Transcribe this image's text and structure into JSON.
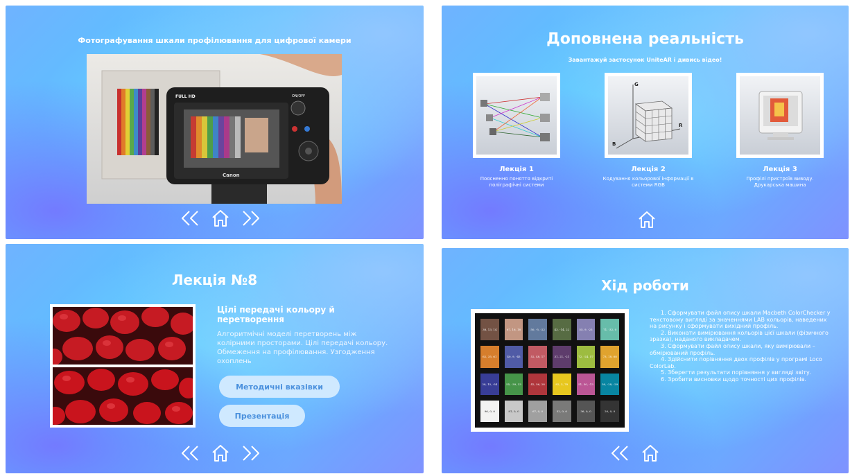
{
  "slide1": {
    "title": "Фотографування шкали профілювання для цифрової камери",
    "camera": {
      "label_fullhd": "FULL HD",
      "label_onoff": "ON/OFF",
      "brand": "Canon"
    }
  },
  "slide2": {
    "title": "Доповнена реальність",
    "subtitle": "Завантажуй застосунок UniteAR і дивись відео!",
    "lectures": [
      {
        "title": "Лекція 1",
        "desc": "Пояснення поняття відкриті поліграфічні системи"
      },
      {
        "title": "Лекція 2",
        "desc": "Кодування кольорової інформації в системи RGB",
        "axes": [
          "G",
          "B",
          "R"
        ]
      },
      {
        "title": "Лекція 3",
        "desc": "Профілі пристроїв виводу. Друкарська машина"
      }
    ]
  },
  "slide3": {
    "title": "Лекція №8",
    "heading": "Цілі передачі кольору й перетворення",
    "body": "Алгоритмічні моделі перетворень між колірними просторами. Цілі передачі кольору. Обмеження на профілювання. Узгодження охоплень",
    "buttons": {
      "guide": "Методичні вказівки",
      "presentation": "Презентація"
    }
  },
  "slide4": {
    "title": "Хід роботи",
    "steps": [
      "1. Сформувати файл опису шкали Macbeth ColorChecker у текстовому вигляді за значеннями LAB кольорів, наведених на рисунку і сформувати вихідний профіль.",
      "2. Виконати вимірювання кольорів цієї шкали (фізичного зразка), наданого викладачем.",
      "3. Сформувати файл опису шкали, яку вимірювали – обмірюваний профіль.",
      "4. Здійснити порівняння двох профілів у програмі Loco ColorLab.",
      "5. Зберегти результати порівняння у вигляді звіту.",
      "6. Зробити висновки щодо точності цих профілів."
    ],
    "patches": [
      {
        "label": "38, 13, 14",
        "color": "#735244"
      },
      {
        "label": "67, 16, 18",
        "color": "#c29682"
      },
      {
        "label": "50, -5, -22",
        "color": "#627a9d"
      },
      {
        "label": "43, -14, 22",
        "color": "#576c43"
      },
      {
        "label": "55, 9, -25",
        "color": "#8580b1"
      },
      {
        "label": "71, -32, 0",
        "color": "#67bdaa"
      },
      {
        "label": "62, 35, 61",
        "color": "#d67e2c"
      },
      {
        "label": "40, 9, -45",
        "color": "#505ba6"
      },
      {
        "label": "52, 48, 17",
        "color": "#c15a63"
      },
      {
        "label": "31, 21, -21",
        "color": "#5e3c6c"
      },
      {
        "label": "72, -24, 57",
        "color": "#9dbc40"
      },
      {
        "label": "73, 18, 68",
        "color": "#e0a32e"
      },
      {
        "label": "28, 15, -54",
        "color": "#383d96"
      },
      {
        "label": "55, -39, 33",
        "color": "#469449"
      },
      {
        "label": "42, 56, 28",
        "color": "#af363c"
      },
      {
        "label": "82, 3, 78",
        "color": "#e7c71f"
      },
      {
        "label": "51, 50, -13",
        "color": "#bb5695"
      },
      {
        "label": "50, -28, -29",
        "color": "#0885a1"
      },
      {
        "label": "96, 0, 0",
        "color": "#f3f3f2"
      },
      {
        "label": "81, 0, 0",
        "color": "#c8c8c8"
      },
      {
        "label": "67, 0, 0",
        "color": "#a0a0a0"
      },
      {
        "label": "52, 0, 0",
        "color": "#7a7a79"
      },
      {
        "label": "36, 0, 0",
        "color": "#555555"
      },
      {
        "label": "20, 0, 0",
        "color": "#343434"
      }
    ]
  }
}
